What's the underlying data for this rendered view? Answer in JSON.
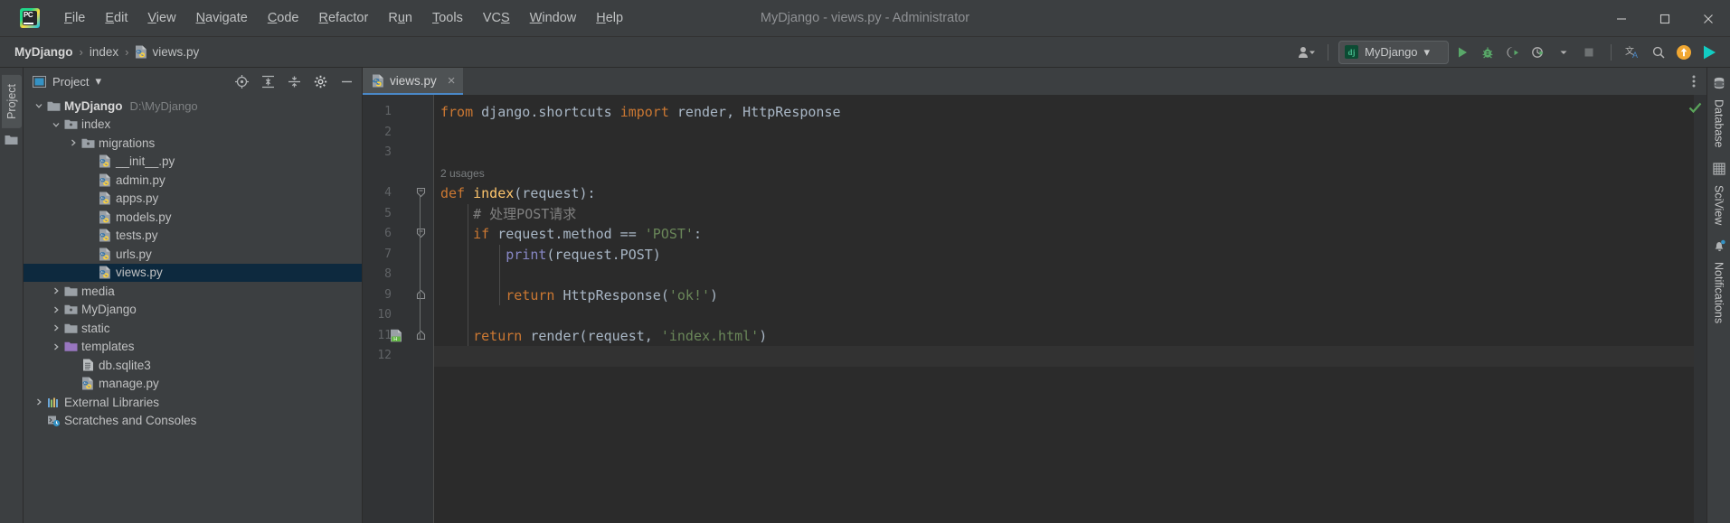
{
  "window": {
    "title": "MyDjango - views.py - Administrator",
    "minimize_label": "Minimize",
    "maximize_label": "Maximize",
    "close_label": "Close"
  },
  "menubar": {
    "items": [
      {
        "label": "File",
        "mnemonic": "F"
      },
      {
        "label": "Edit",
        "mnemonic": "E"
      },
      {
        "label": "View",
        "mnemonic": "V"
      },
      {
        "label": "Navigate",
        "mnemonic": "N"
      },
      {
        "label": "Code",
        "mnemonic": "C"
      },
      {
        "label": "Refactor",
        "mnemonic": "R"
      },
      {
        "label": "Run",
        "mnemonic": "u"
      },
      {
        "label": "Tools",
        "mnemonic": "T"
      },
      {
        "label": "VCS",
        "mnemonic": "S"
      },
      {
        "label": "Window",
        "mnemonic": "W"
      },
      {
        "label": "Help",
        "mnemonic": "H"
      }
    ]
  },
  "navbar": {
    "breadcrumb": [
      {
        "label": "MyDjango",
        "icon": ""
      },
      {
        "label": "index",
        "icon": ""
      },
      {
        "label": "views.py",
        "icon": "python-file-icon"
      }
    ],
    "separator": "›",
    "run_config": {
      "label": "MyDjango",
      "icon": "django-icon",
      "chevron": "▾"
    },
    "actions": [
      {
        "name": "user-account-icon",
        "label": ""
      },
      {
        "name": "run-icon",
        "label": "Run"
      },
      {
        "name": "debug-icon",
        "label": "Debug"
      },
      {
        "name": "run-coverage-icon",
        "label": "Run with Coverage"
      },
      {
        "name": "profile-icon",
        "label": "Profile"
      },
      {
        "name": "stop-icon",
        "label": "Stop"
      },
      {
        "name": "translate-icon",
        "label": "Translate"
      },
      {
        "name": "search-everywhere-icon",
        "label": "Search Everywhere"
      },
      {
        "name": "update-project-icon",
        "label": "Update Project"
      },
      {
        "name": "ide-feature-icon",
        "label": ""
      }
    ]
  },
  "left_strip": {
    "project_tab": "Project"
  },
  "project_panel": {
    "title": "Project",
    "chevron": "▾",
    "toolbar": [
      {
        "name": "select-opened-file-icon",
        "label": "Select Opened File"
      },
      {
        "name": "expand-all-icon",
        "label": "Expand All"
      },
      {
        "name": "collapse-all-icon",
        "label": "Collapse All"
      },
      {
        "name": "settings-gear-icon",
        "label": "Settings"
      },
      {
        "name": "hide-panel-icon",
        "label": "Hide"
      }
    ],
    "tree": [
      {
        "label": "MyDjango",
        "path": "D:\\MyDjango",
        "icon": "folder-icon",
        "indent": 0,
        "arrow": "down",
        "bold": true,
        "selected": false
      },
      {
        "label": "index",
        "path": "",
        "icon": "module-folder-icon",
        "indent": 1,
        "arrow": "down",
        "bold": false,
        "selected": false
      },
      {
        "label": "migrations",
        "path": "",
        "icon": "module-folder-icon",
        "indent": 2,
        "arrow": "right",
        "bold": false,
        "selected": false
      },
      {
        "label": "__init__.py",
        "path": "",
        "icon": "python-file-icon",
        "indent": 3,
        "arrow": "none",
        "bold": false,
        "selected": false
      },
      {
        "label": "admin.py",
        "path": "",
        "icon": "python-file-icon",
        "indent": 3,
        "arrow": "none",
        "bold": false,
        "selected": false
      },
      {
        "label": "apps.py",
        "path": "",
        "icon": "python-file-icon",
        "indent": 3,
        "arrow": "none",
        "bold": false,
        "selected": false
      },
      {
        "label": "models.py",
        "path": "",
        "icon": "python-file-icon",
        "indent": 3,
        "arrow": "none",
        "bold": false,
        "selected": false
      },
      {
        "label": "tests.py",
        "path": "",
        "icon": "python-file-icon",
        "indent": 3,
        "arrow": "none",
        "bold": false,
        "selected": false
      },
      {
        "label": "urls.py",
        "path": "",
        "icon": "python-file-icon",
        "indent": 3,
        "arrow": "none",
        "bold": false,
        "selected": false
      },
      {
        "label": "views.py",
        "path": "",
        "icon": "python-file-icon",
        "indent": 3,
        "arrow": "none",
        "bold": false,
        "selected": true
      },
      {
        "label": "media",
        "path": "",
        "icon": "folder-icon",
        "indent": 1,
        "arrow": "right",
        "bold": false,
        "selected": false
      },
      {
        "label": "MyDjango",
        "path": "",
        "icon": "module-folder-icon",
        "indent": 1,
        "arrow": "right",
        "bold": false,
        "selected": false
      },
      {
        "label": "static",
        "path": "",
        "icon": "folder-icon",
        "indent": 1,
        "arrow": "right",
        "bold": false,
        "selected": false
      },
      {
        "label": "templates",
        "path": "",
        "icon": "templates-folder-icon",
        "indent": 1,
        "arrow": "right",
        "bold": false,
        "selected": false
      },
      {
        "label": "db.sqlite3",
        "path": "",
        "icon": "sqlite-file-icon",
        "indent": 2,
        "arrow": "none",
        "bold": false,
        "selected": false
      },
      {
        "label": "manage.py",
        "path": "",
        "icon": "python-file-icon",
        "indent": 2,
        "arrow": "none",
        "bold": false,
        "selected": false
      },
      {
        "label": "External Libraries",
        "path": "",
        "icon": "libraries-icon",
        "indent": 0,
        "arrow": "right",
        "bold": false,
        "selected": false
      },
      {
        "label": "Scratches and Consoles",
        "path": "",
        "icon": "scratches-icon",
        "indent": 0,
        "arrow": "none",
        "bold": false,
        "selected": false
      }
    ]
  },
  "editor": {
    "tabs": [
      {
        "label": "views.py",
        "icon": "python-file-icon",
        "close": "×",
        "active": true
      }
    ],
    "options_icon": "more-options-icon",
    "inspection_status": "ok-checkmark",
    "inlay_hints": [
      {
        "text": "2 usages",
        "line": 4
      }
    ],
    "gutter_icons": [
      {
        "line": 11,
        "name": "html-file-gutter-icon"
      }
    ],
    "current_line": 12,
    "lines": [
      {
        "num": 1,
        "tokens": [
          {
            "t": "from ",
            "c": "kw"
          },
          {
            "t": "django.shortcuts ",
            "c": "pln"
          },
          {
            "t": "import ",
            "c": "kw"
          },
          {
            "t": "render, HttpResponse",
            "c": "pln"
          }
        ]
      },
      {
        "num": 2,
        "tokens": []
      },
      {
        "num": 3,
        "tokens": []
      },
      {
        "num": 4,
        "tokens": [
          {
            "t": "def ",
            "c": "kw"
          },
          {
            "t": "index",
            "c": "fn"
          },
          {
            "t": "(request):",
            "c": "pln"
          }
        ]
      },
      {
        "num": 5,
        "tokens": [
          {
            "t": "    # 处理POST请求",
            "c": "cmt"
          }
        ]
      },
      {
        "num": 6,
        "tokens": [
          {
            "t": "    ",
            "c": "pln"
          },
          {
            "t": "if ",
            "c": "kw"
          },
          {
            "t": "request.method == ",
            "c": "pln"
          },
          {
            "t": "'POST'",
            "c": "str"
          },
          {
            "t": ":",
            "c": "pln"
          }
        ]
      },
      {
        "num": 7,
        "tokens": [
          {
            "t": "        ",
            "c": "pln"
          },
          {
            "t": "print",
            "c": "bif"
          },
          {
            "t": "(request.POST)",
            "c": "pln"
          }
        ]
      },
      {
        "num": 8,
        "tokens": []
      },
      {
        "num": 9,
        "tokens": [
          {
            "t": "        ",
            "c": "pln"
          },
          {
            "t": "return ",
            "c": "kw"
          },
          {
            "t": "HttpResponse(",
            "c": "pln"
          },
          {
            "t": "'ok!'",
            "c": "str"
          },
          {
            "t": ")",
            "c": "pln"
          }
        ]
      },
      {
        "num": 10,
        "tokens": []
      },
      {
        "num": 11,
        "tokens": [
          {
            "t": "    ",
            "c": "pln"
          },
          {
            "t": "return ",
            "c": "kw"
          },
          {
            "t": "render(request, ",
            "c": "pln"
          },
          {
            "t": "'index.html'",
            "c": "str"
          },
          {
            "t": ")",
            "c": "pln"
          }
        ]
      },
      {
        "num": 12,
        "tokens": []
      }
    ]
  },
  "right_strip": {
    "tabs": [
      {
        "label": "Database",
        "icon": "database-icon",
        "badge": false
      },
      {
        "label": "SciView",
        "icon": "sciview-icon",
        "badge": false
      },
      {
        "label": "Notifications",
        "icon": "notifications-bell-icon",
        "badge": true
      }
    ]
  },
  "colors": {
    "accent_blue": "#4a88c7",
    "selection": "#0d293e",
    "keyword": "#cc7832",
    "string": "#6a8759",
    "function": "#ffc66d",
    "comment": "#808080",
    "builtin": "#8888c6",
    "panel_bg": "#3c3f41",
    "editor_bg": "#2b2b2b",
    "green_run": "#59a869",
    "orange": "#f0a732"
  }
}
